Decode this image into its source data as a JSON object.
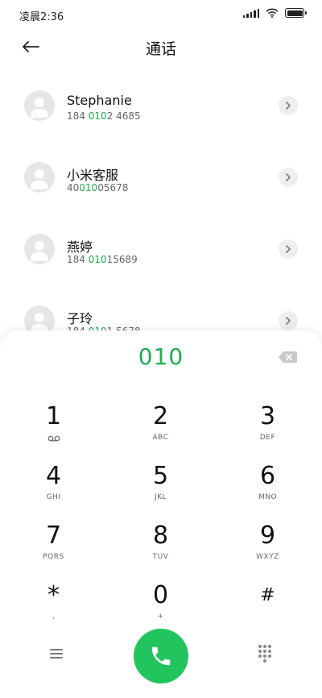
{
  "status_bar": {
    "time": "凌晨2:36"
  },
  "header": {
    "title": "通话"
  },
  "contacts": [
    {
      "name": "Stephanie",
      "number_pre": "184 ",
      "number_match": "0102",
      "number_post": " 4685",
      "match_prefix_plain": "",
      "match_green": "010"
    },
    {
      "name": "小米客服",
      "number_pre": "40",
      "number_match": "010",
      "number_post": "05678"
    },
    {
      "name": "燕婷",
      "number_pre": "184 ",
      "number_match": "010",
      "number_post": "15689"
    },
    {
      "name": "子玲",
      "number_pre": "184 ",
      "number_match": "010",
      "number_post": "1 5678"
    }
  ],
  "dialer": {
    "input": "010",
    "keys": [
      {
        "digit": "1",
        "letters": "voicemail-icon"
      },
      {
        "digit": "2",
        "letters": "ABC"
      },
      {
        "digit": "3",
        "letters": "DEF"
      },
      {
        "digit": "4",
        "letters": "GHI"
      },
      {
        "digit": "5",
        "letters": "JKL"
      },
      {
        "digit": "6",
        "letters": "MNO"
      },
      {
        "digit": "7",
        "letters": "PQRS"
      },
      {
        "digit": "8",
        "letters": "TUV"
      },
      {
        "digit": "9",
        "letters": "WXYZ"
      },
      {
        "digit": "*",
        "letters": ","
      },
      {
        "digit": "0",
        "letters": "+"
      },
      {
        "digit": "#",
        "letters": ""
      }
    ]
  },
  "colors": {
    "accent": "#1fae4f",
    "call_button": "#22c45e"
  }
}
